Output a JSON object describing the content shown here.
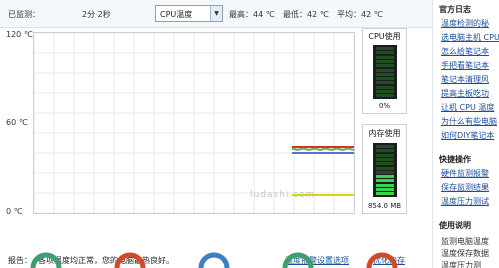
{
  "topbar": {
    "monitored_label": "已监测：",
    "monitored_value": "2分 2秒",
    "sensor_select": "CPU温度",
    "max": "最高：44 ℃",
    "min": "最低：42 ℃",
    "avg": "平均：42 ℃"
  },
  "chart_data": {
    "type": "line",
    "yticks": [
      "120 ℃",
      "60 ℃",
      "0 ℃"
    ],
    "ylim": [
      0,
      120
    ],
    "grid": true,
    "series": [
      {
        "color": "#c0392b",
        "values": [
          44,
          44,
          44,
          44,
          44,
          44,
          44,
          44,
          44,
          44,
          44,
          44
        ]
      },
      {
        "color": "#7aa64a",
        "values": [
          43,
          42,
          43,
          42,
          43,
          42,
          43,
          42,
          43,
          42,
          43,
          42
        ]
      },
      {
        "color": "#5b6ee1",
        "values": [
          40,
          40,
          40,
          40,
          40,
          40,
          40,
          40,
          40,
          40,
          40,
          40
        ]
      },
      {
        "color": "#d9d600",
        "values": [
          12,
          12,
          12,
          12,
          12,
          12,
          12,
          12,
          12,
          12,
          12,
          12
        ]
      }
    ]
  },
  "cpu": {
    "title": "CPU使用",
    "value": "0%",
    "fraction": 0.0
  },
  "mem": {
    "title": "内存使用",
    "value": "854.0 MB",
    "fraction": 0.45
  },
  "report": {
    "label": "报告：",
    "text": "各项温度均正常，您的电脑散热良好。",
    "link1": "温度报警设置选项",
    "link2": "优化内存"
  },
  "watermark": "ludashi.com",
  "sidebar": {
    "sec1": "官方日志",
    "links1": [
      "温度检测的秘",
      "选电脑主机 CPU",
      "怎么给笔记本",
      "手把看笔记本",
      "笔记本清理风",
      "提高主板吃功",
      "让机 CPU 温度",
      "为什么有些电脑",
      "如何DIY笔记本"
    ],
    "sec2": "快捷操作",
    "links2": [
      "硬件监测报警",
      "保存监测结果",
      "温度压力测试"
    ],
    "sec3": "使用说明",
    "text3": [
      "监测电脑温度",
      "温度保存数据",
      "温度压力测"
    ]
  },
  "gauges": [
    {
      "color": "#3f9e6d"
    },
    {
      "color": "#d04a2a"
    },
    {
      "color": "#3f7fc0"
    },
    {
      "color": "#3f9e6d"
    },
    {
      "color": "#d04a2a"
    }
  ]
}
